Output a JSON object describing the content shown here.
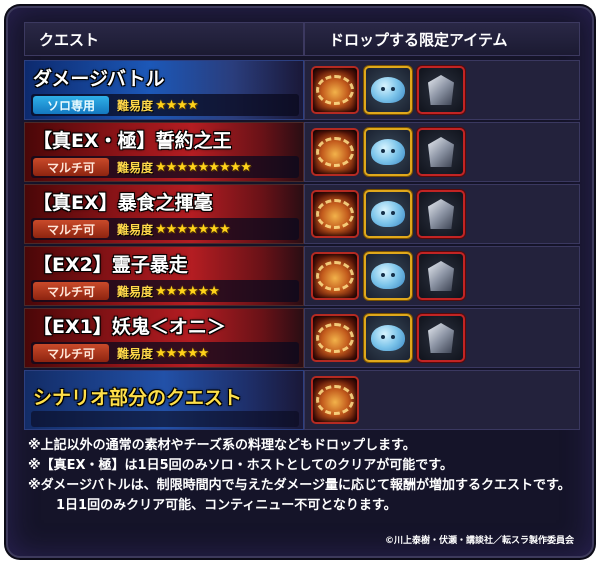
{
  "header": {
    "quest_col": "クエスト",
    "drop_col": "ドロップする限定アイテム"
  },
  "difficulty_label": "難易度",
  "quests": [
    {
      "title": "ダメージバトル",
      "badge": "ソロ専用",
      "badge_type": "solo",
      "stars": 4,
      "theme": "blue",
      "drops": [
        "dish-icon",
        "slime-icon",
        "armor-icon"
      ]
    },
    {
      "title": "【真EX・極】誓約之王",
      "badge": "マルチ可",
      "badge_type": "multi",
      "stars": 9,
      "theme": "red",
      "drops": [
        "dish-icon",
        "slime-icon",
        "armor-icon"
      ]
    },
    {
      "title": "【真EX】暴食之揮毫",
      "badge": "マルチ可",
      "badge_type": "multi",
      "stars": 7,
      "theme": "red",
      "drops": [
        "dish-icon",
        "slime-icon",
        "armor-icon"
      ]
    },
    {
      "title": "【EX2】霊子暴走",
      "badge": "マルチ可",
      "badge_type": "multi",
      "stars": 6,
      "theme": "red",
      "drops": [
        "dish-icon",
        "slime-icon",
        "armor-icon"
      ]
    },
    {
      "title": "【EX1】妖鬼＜オニ＞",
      "badge": "マルチ可",
      "badge_type": "multi",
      "stars": 5,
      "theme": "red",
      "drops": [
        "dish-icon",
        "slime-icon",
        "armor-icon"
      ]
    }
  ],
  "scenario": {
    "title": "シナリオ部分のクエスト",
    "drops": [
      "dish-icon"
    ]
  },
  "notes": [
    "※上記以外の通常の素材やチーズ系の料理などもドロップします。",
    "※【真EX・極】は1日5回のみソロ・ホストとしてのクリアが可能です。",
    "※ダメージバトルは、制限時間内で与えたダメージ量に応じて報酬が増加するクエストです。",
    "1日1回のみクリア可能、コンティニュー不可となります。"
  ],
  "copyright": "©川上泰樹・伏瀬・講談社／転スラ製作委員会",
  "colors": {
    "background": "#151429",
    "star": "#ffd21a",
    "scenario_title": "#ffe04a"
  }
}
